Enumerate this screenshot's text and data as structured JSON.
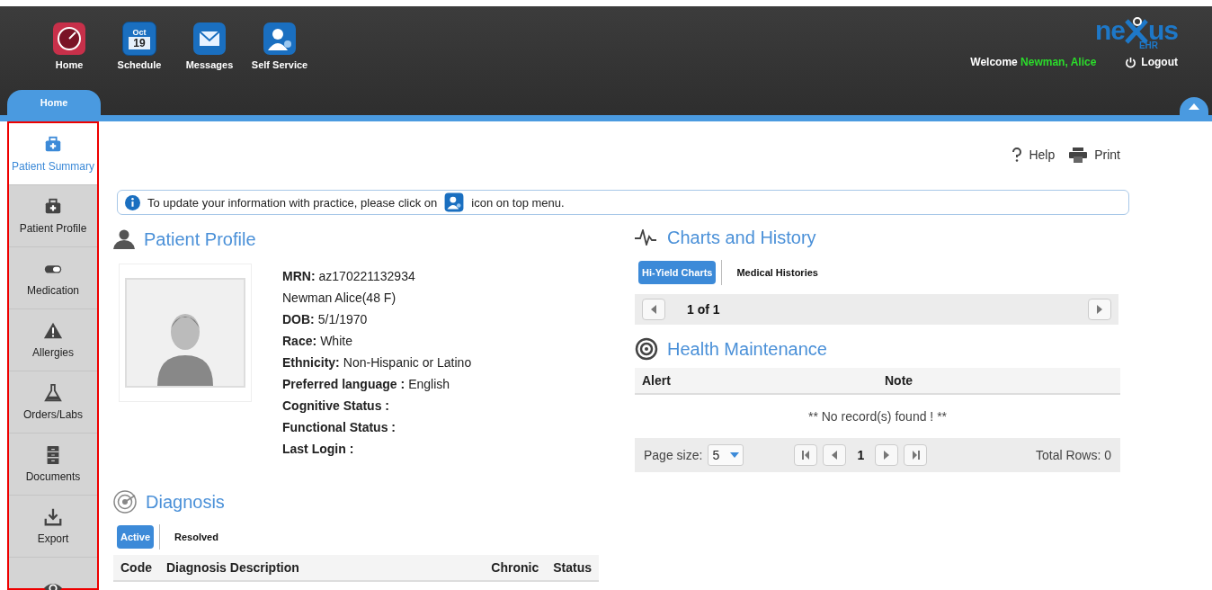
{
  "top_nav": [
    {
      "kind": "gauge",
      "label": "Home"
    },
    {
      "kind": "calendar",
      "label": "Schedule",
      "month": "Oct",
      "day": "19"
    },
    {
      "kind": "mail",
      "label": "Messages"
    },
    {
      "kind": "user-gear",
      "label": "Self Service"
    }
  ],
  "logo": {
    "left": "ne",
    "right": "us",
    "sub": "EHR"
  },
  "welcome": {
    "text": "Welcome",
    "user": "Newman, Alice"
  },
  "logout": "Logout",
  "tabs": [
    {
      "label": "Home",
      "selected": true
    }
  ],
  "sidebar": {
    "items": [
      {
        "kind": "kit",
        "label": "Patient Summary",
        "selected": true
      },
      {
        "kind": "kit",
        "label": "Patient Profile",
        "selected": false
      },
      {
        "kind": "pill",
        "label": "Medication",
        "selected": false
      },
      {
        "kind": "warning",
        "label": "Allergies",
        "selected": false
      },
      {
        "kind": "flask",
        "label": "Orders/Labs",
        "selected": false
      },
      {
        "kind": "cabinet",
        "label": "Documents",
        "selected": false
      },
      {
        "kind": "export",
        "label": "Export",
        "selected": false
      },
      {
        "kind": "eye",
        "selected": false
      }
    ]
  },
  "toolbar": {
    "help": "Help",
    "print": "Print"
  },
  "info": {
    "before": "To update your information with practice, please click on",
    "after": "icon on top menu."
  },
  "patient_profile": {
    "title": "Patient Profile",
    "fields": [
      {
        "label": "MRN:",
        "value": "az170221132934"
      },
      {
        "value": "Newman Alice(48 F)"
      },
      {
        "label": "DOB:",
        "value": "5/1/1970"
      },
      {
        "label": "Race:",
        "value": "White"
      },
      {
        "label": "Ethnicity:",
        "value": "Non-Hispanic or Latino"
      },
      {
        "label": "Preferred language :",
        "value": "English"
      },
      {
        "label": "Cognitive Status :"
      },
      {
        "label": "Functional Status :"
      },
      {
        "label": "Last Login :"
      }
    ]
  },
  "diagnosis": {
    "title": "Diagnosis",
    "tabs": [
      {
        "label": "Active",
        "selected": true
      },
      {
        "label": "Resolved",
        "selected": false
      }
    ],
    "columns": [
      "Code",
      "Diagnosis Description",
      "Chronic",
      "Status"
    ]
  },
  "charts_history": {
    "title": "Charts and History",
    "tabs": [
      {
        "label": "Hi-Yield Charts",
        "selected": true
      },
      {
        "label": "Medical Histories",
        "selected": false
      }
    ],
    "pager": "1 of 1"
  },
  "health_maintenance": {
    "title": "Health Maintenance",
    "columns": [
      "Alert",
      "Note"
    ],
    "empty": "** No record(s) found ! **",
    "page_size_label": "Page size:",
    "page_size": "5",
    "page": "1",
    "total": "Total Rows: 0"
  }
}
